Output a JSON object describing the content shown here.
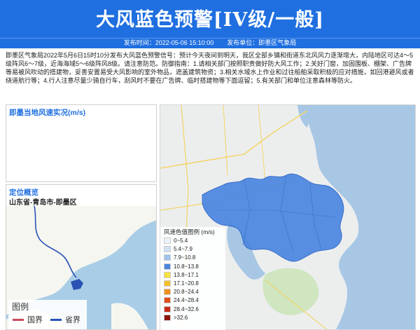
{
  "header": {
    "title": "大风蓝色预警[IV级/一般]",
    "publish_label": "发布时间：2022-05-06 15:10:00",
    "publisher_label": "发布单位：即墨区气象局"
  },
  "description": "即墨区气象局2022年5月6日15时10分发布大风蓝色预警信号：预计今天夜间到明天，我区全部乡镇和街道东北风风力逐渐增大，内陆地区可达4～5级阵风6～7级，近海海域5～6级阵风8级。请注意防范。防御指南：1.请相关部门按照职责做好防大风工作；2.关好门窗，加固围板、棚架、广告牌等易被风吹动的搭建物，妥善安置易受大风影响的室外物品，遮盖建筑物资；3.相关水域水上作业和过往船舶采取积极的应对措施，如回港避风或者绕道航行等；4.行人注意尽量少骑自行车，刮风时不要在广告牌、临时搭建物等下面逗留；5.有关部门和单位注意森林等防火。",
  "panels": {
    "wind_title": "即墨当地风速实况(m/s)",
    "location_title": "定位概览",
    "location_region": "山东省-青岛市-即墨区"
  },
  "wind_legend": {
    "title": "风速色值图例 (m/s)",
    "items": [
      {
        "label": "0~5.4",
        "color": "#eef3fb"
      },
      {
        "label": "5.4~7.9",
        "color": "#cfe0f7"
      },
      {
        "label": "7.9~10.8",
        "color": "#9dc3ee"
      },
      {
        "label": "10.8~13.8",
        "color": "#4a86df"
      },
      {
        "label": "13.8~17.1",
        "color": "#f6e43c"
      },
      {
        "label": "17.1~20.8",
        "color": "#f5bf2d"
      },
      {
        "label": "20.8~24.4",
        "color": "#f18f1f"
      },
      {
        "label": "24.4~28.4",
        "color": "#e24f1b"
      },
      {
        "label": "28.4~32.6",
        "color": "#c72b17"
      },
      {
        "label": ">32.6",
        "color": "#8c1408"
      }
    ]
  },
  "location_legend": {
    "title": "图例",
    "national_border": "国界",
    "provincial_border": "省界",
    "national_color": "#c84a5b",
    "provincial_color": "#2a53b5"
  },
  "colors": {
    "header_bg": "#1f6fe0",
    "accent": "#1f6fe0",
    "region_fill": "#4a86df"
  }
}
